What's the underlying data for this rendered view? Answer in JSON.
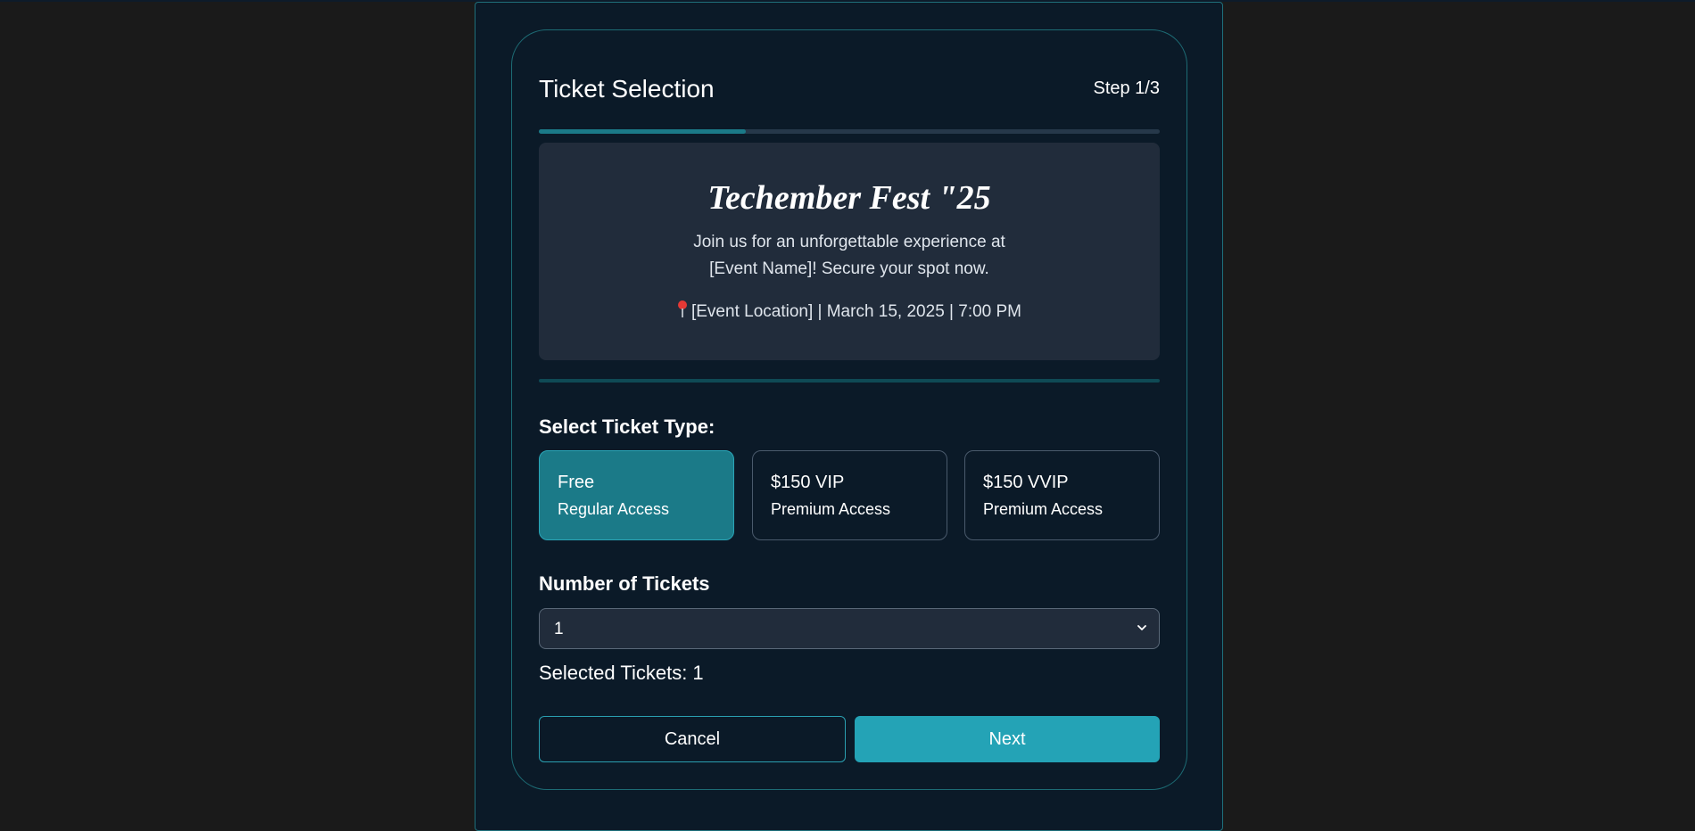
{
  "header": {
    "title": "Ticket Selection",
    "step": "Step 1/3",
    "progress_fraction": 0.333
  },
  "event": {
    "title": "Techember Fest \"25",
    "description_line1": "Join us for an unforgettable experience at",
    "description_line2": "[Event Name]! Secure your spot now.",
    "pin_icon": "pin-icon",
    "meta": "[Event Location] | March 15, 2025 | 7:00 PM"
  },
  "ticket_type": {
    "label": "Select Ticket Type:",
    "options": [
      {
        "price": "Free",
        "access": "Regular Access",
        "selected": true
      },
      {
        "price": "$150 VIP",
        "access": "Premium Access",
        "selected": false
      },
      {
        "price": "$150 VVIP",
        "access": "Premium Access",
        "selected": false
      }
    ]
  },
  "ticket_count": {
    "label": "Number of Tickets",
    "selected_value": "1",
    "selected_text": "Selected Tickets: 1"
  },
  "actions": {
    "cancel_label": "Cancel",
    "next_label": "Next"
  },
  "colors": {
    "accent": "#24a3b6",
    "selected_card": "#1b7a88",
    "panel": "#212c3b",
    "background": "#0b1a28"
  }
}
